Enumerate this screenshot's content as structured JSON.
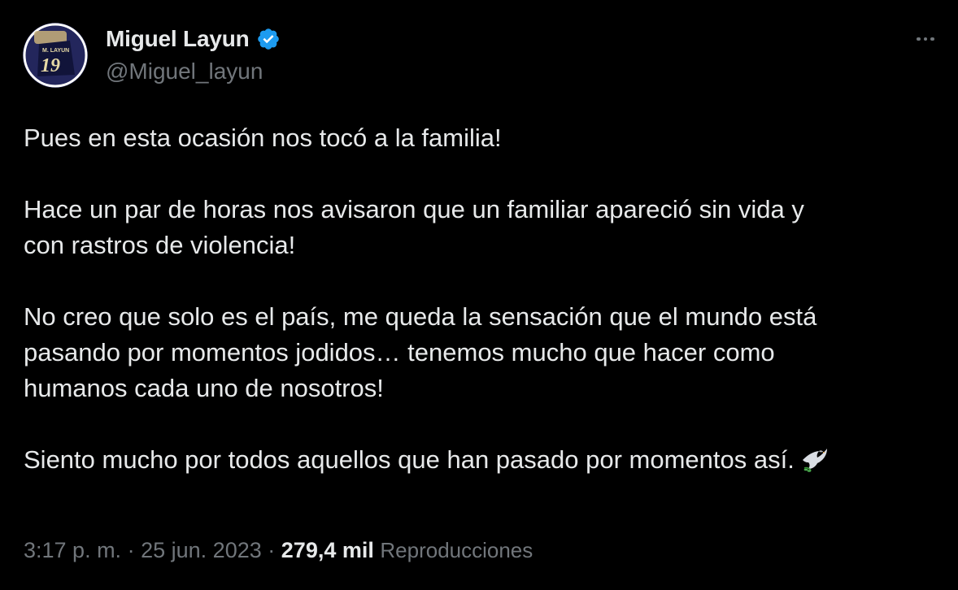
{
  "author": {
    "display_name": "Miguel Layun",
    "handle": "@Miguel_layun",
    "avatar_jersey_text": "M. LAYUN",
    "avatar_jersey_number": "19"
  },
  "tweet": {
    "paragraphs": [
      "Pues en esta ocasión nos tocó a la familia!",
      "Hace un par de horas nos avisaron que un familiar apareció sin vida y\ncon rastros de violencia!",
      "No creo que solo es el país, me queda la sensación que el mundo está\npasando por momentos jodidos… tenemos mucho que hacer como\nhumanos cada uno de nosotros!",
      "Siento mucho por todos aquellos que han pasado por momentos así."
    ],
    "trailing_emoji": "dove-icon"
  },
  "meta": {
    "time": "3:17 p. m.",
    "separator": "·",
    "date": "25 jun. 2023",
    "views_count": "279,4 mil",
    "views_label": "Reproducciones"
  },
  "colors": {
    "background": "#000000",
    "text_primary": "#e7e9ea",
    "text_secondary": "#71767b",
    "verified_blue": "#1d9bf0"
  }
}
